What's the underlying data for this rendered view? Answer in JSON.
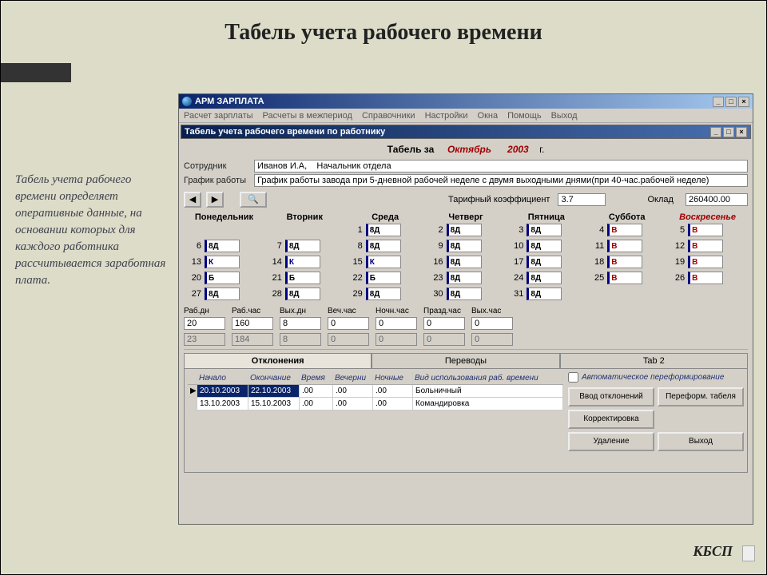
{
  "slide_title": "Табель учета рабочего времени",
  "side_text": "Табель учета рабочего времени определяет оперативные данные, на основании которых для каждого работника рассчитывается заработная плата.",
  "footer": "КБСП",
  "outer_window": {
    "title": "АРМ ЗАРПЛАТА",
    "menu": [
      "Расчет зарплаты",
      "Расчеты в межпериод",
      "Справочники",
      "Настройки",
      "Окна",
      "Помощь",
      "Выход"
    ]
  },
  "inner_window": {
    "title": "Табель учета рабочего времени по работнику"
  },
  "period": {
    "label": "Табель за",
    "month": "Октябрь",
    "year": "2003",
    "suffix": "г."
  },
  "fields": {
    "employee_label": "Сотрудник",
    "employee_value": "Иванов И.А,    Начальник отдела",
    "schedule_label": "График работы",
    "schedule_value": "График работы завода при 5-дневной рабочей неделе с двумя выходными днями(при 40-час.рабочей неделе)",
    "tariff_label": "Тарифный коэффициент",
    "tariff_value": "3.7",
    "salary_label": "Оклад",
    "salary_value": "260400.00"
  },
  "weekdays": [
    "Понедельник",
    "Вторник",
    "Среда",
    "Четверг",
    "Пятница",
    "Суббота",
    "Воскресенье"
  ],
  "calendar": [
    {
      "day": "",
      "code": ""
    },
    {
      "day": "",
      "code": ""
    },
    {
      "day": "1",
      "code": "8Д"
    },
    {
      "day": "2",
      "code": "8Д"
    },
    {
      "day": "3",
      "code": "8Д"
    },
    {
      "day": "4",
      "code": "В"
    },
    {
      "day": "5",
      "code": "В"
    },
    {
      "day": "6",
      "code": "8Д"
    },
    {
      "day": "7",
      "code": "8Д"
    },
    {
      "day": "8",
      "code": "8Д"
    },
    {
      "day": "9",
      "code": "8Д"
    },
    {
      "day": "10",
      "code": "8Д"
    },
    {
      "day": "11",
      "code": "В"
    },
    {
      "day": "12",
      "code": "В"
    },
    {
      "day": "13",
      "code": "К"
    },
    {
      "day": "14",
      "code": "К"
    },
    {
      "day": "15",
      "code": "К"
    },
    {
      "day": "16",
      "code": "8Д"
    },
    {
      "day": "17",
      "code": "8Д"
    },
    {
      "day": "18",
      "code": "В"
    },
    {
      "day": "19",
      "code": "В"
    },
    {
      "day": "20",
      "code": "Б"
    },
    {
      "day": "21",
      "code": "Б"
    },
    {
      "day": "22",
      "code": "Б"
    },
    {
      "day": "23",
      "code": "8Д"
    },
    {
      "day": "24",
      "code": "8Д"
    },
    {
      "day": "25",
      "code": "В"
    },
    {
      "day": "26",
      "code": "В"
    },
    {
      "day": "27",
      "code": "8Д"
    },
    {
      "day": "28",
      "code": "8Д"
    },
    {
      "day": "29",
      "code": "8Д"
    },
    {
      "day": "30",
      "code": "8Д"
    },
    {
      "day": "31",
      "code": "8Д"
    },
    {
      "day": "",
      "code": ""
    },
    {
      "day": "",
      "code": ""
    }
  ],
  "totals": {
    "labels": [
      "Раб.дн",
      "Раб.час",
      "Вых.дн",
      "Веч.час",
      "Ночн.час",
      "Празд.час",
      "Вых.час"
    ],
    "row1": [
      "20",
      "160",
      "8",
      "0",
      "0",
      "0",
      "0"
    ],
    "row2": [
      "23",
      "184",
      "8",
      "0",
      "0",
      "0",
      "0"
    ]
  },
  "tabs": [
    "Отклонения",
    "Переводы",
    "Tab 2"
  ],
  "deviations": {
    "headers": [
      "",
      "Начало",
      "Окончание",
      "Время",
      "Вечерни",
      "Ночные",
      "Вид использования раб. времени"
    ],
    "rows": [
      {
        "marker": "▶",
        "start": "20.10.2003",
        "end": "22.10.2003",
        "time": ".00",
        "evening": ".00",
        "night": ".00",
        "type": "Больничный",
        "selected": true
      },
      {
        "marker": "",
        "start": "13.10.2003",
        "end": "15.10.2003",
        "time": ".00",
        "evening": ".00",
        "night": ".00",
        "type": "Командировка",
        "selected": false
      }
    ]
  },
  "right_panel": {
    "auto_reform": "Автоматическое переформирование",
    "buttons": [
      "Ввод отклонений",
      "Переформ. табеля",
      "Корректировка",
      "",
      "Удаление",
      "Выход"
    ]
  },
  "win_controls": {
    "min": "_",
    "max": "□",
    "close": "×"
  }
}
